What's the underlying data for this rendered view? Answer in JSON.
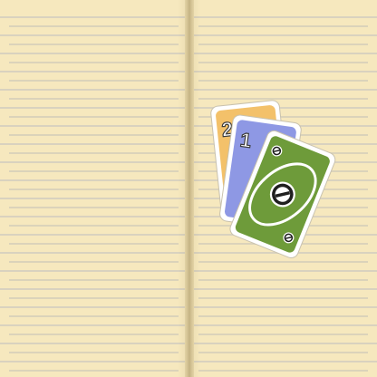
{
  "cards": {
    "card_back": {
      "number": "2",
      "color": "#f3c16a"
    },
    "card_middle": {
      "number": "1",
      "color": "#8e98e4"
    },
    "card_front": {
      "symbol": "skip",
      "color": "#6e9b3a"
    }
  },
  "colors": {
    "page": "#f6e8be",
    "rule_line": "#d8d0b9",
    "spine": "#cdbb8c"
  }
}
